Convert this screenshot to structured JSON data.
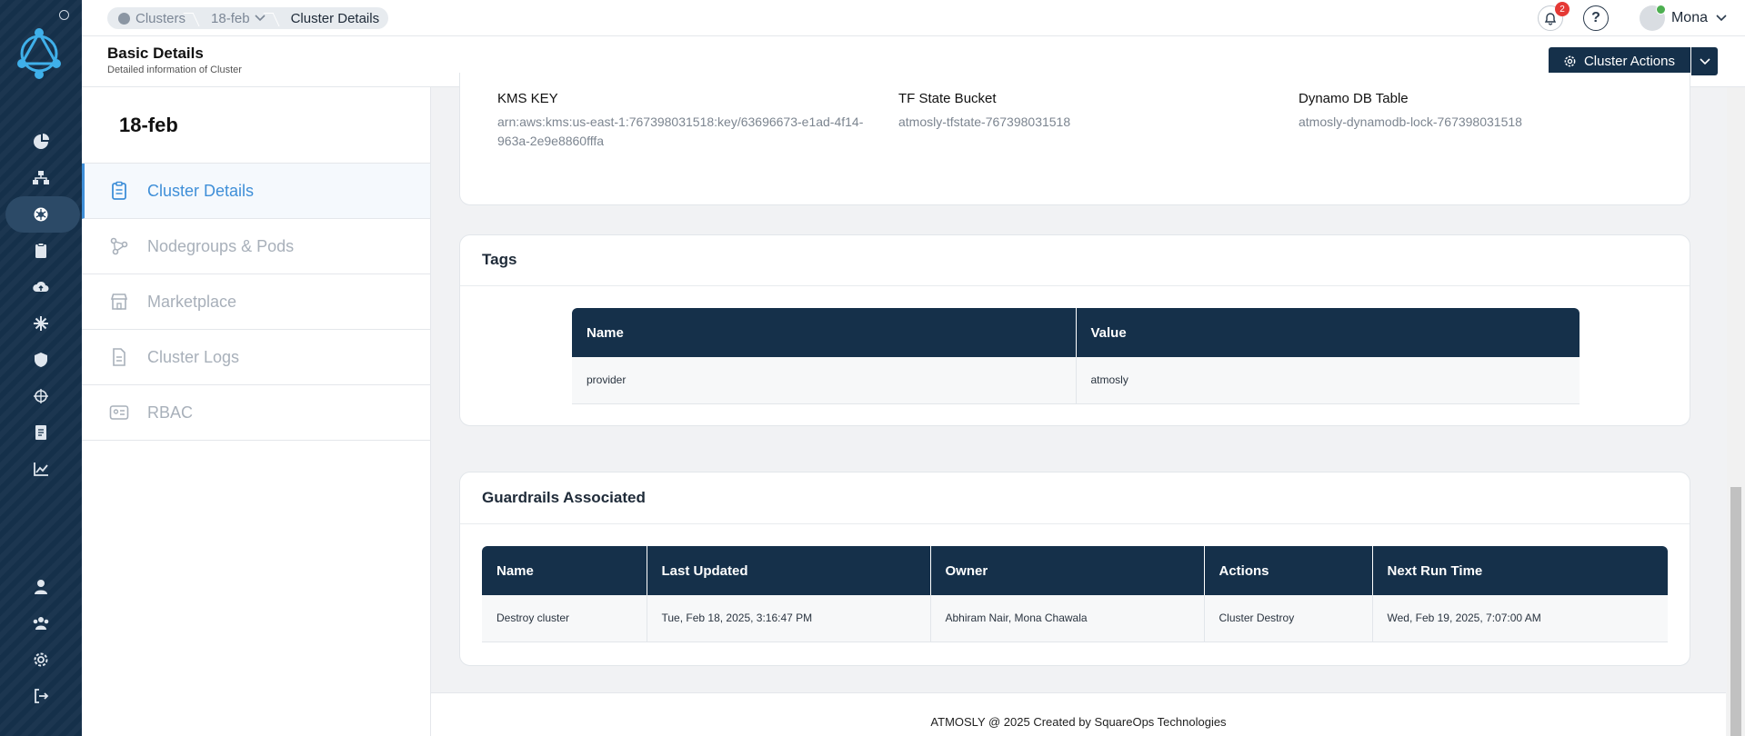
{
  "breadcrumb": {
    "items": [
      "Clusters",
      "18-feb",
      "Cluster Details"
    ]
  },
  "header": {
    "notifications_count": "2",
    "user_name": "Mona"
  },
  "page": {
    "title": "Basic Details",
    "subtitle": "Detailed information of Cluster",
    "actions_label": "Cluster Actions"
  },
  "sidebar": {
    "cluster_name": "18-feb",
    "items": [
      {
        "label": "Cluster Details",
        "icon": "clipboard-icon"
      },
      {
        "label": "Nodegroups & Pods",
        "icon": "nodes-icon"
      },
      {
        "label": "Marketplace",
        "icon": "store-icon"
      },
      {
        "label": "Cluster Logs",
        "icon": "document-icon"
      },
      {
        "label": "RBAC",
        "icon": "id-card-icon"
      }
    ]
  },
  "details": {
    "fields": [
      {
        "label": "KMS KEY",
        "value": "arn:aws:kms:us-east-1:767398031518:key/63696673-e1ad-4f14-963a-2e9e8860fffa"
      },
      {
        "label": "TF State Bucket",
        "value": "atmosly-tfstate-767398031518"
      },
      {
        "label": "Dynamo DB Table",
        "value": "atmosly-dynamodb-lock-767398031518"
      }
    ]
  },
  "tags": {
    "title": "Tags",
    "columns": [
      "Name",
      "Value"
    ],
    "rows": [
      [
        "provider",
        "atmosly"
      ]
    ]
  },
  "guardrails": {
    "title": "Guardrails Associated",
    "columns": [
      "Name",
      "Last Updated",
      "Owner",
      "Actions",
      "Next Run Time"
    ],
    "rows": [
      [
        "Destroy cluster",
        "Tue, Feb 18, 2025, 3:16:47 PM",
        "Abhiram Nair, Mona Chawala",
        "Cluster Destroy",
        "Wed, Feb 19, 2025, 7:07:00 AM"
      ]
    ]
  },
  "footer": {
    "text": "ATMOSLY @ 2025 Created by SquareOps Technologies"
  },
  "colors": {
    "navy": "#15304a",
    "accent": "#3f8fd8",
    "badge": "#e53935"
  }
}
